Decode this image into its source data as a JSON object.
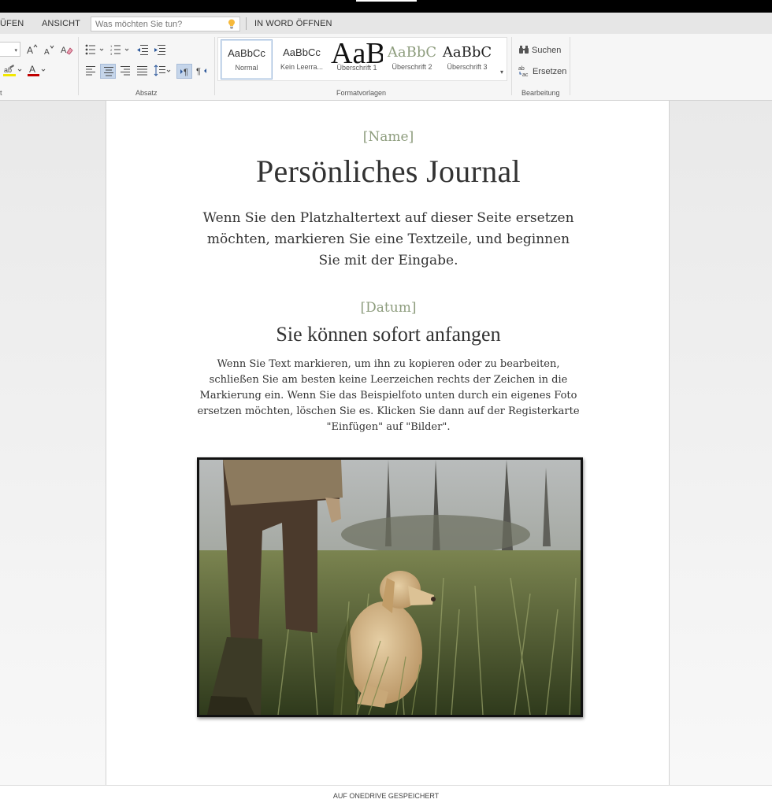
{
  "menubar": {
    "items": [
      "ÜFEN",
      "ANSICHT"
    ],
    "tell_me_placeholder": "Was möchten Sie tun?",
    "open_in_word": "IN WORD ÖFFNEN"
  },
  "ribbon": {
    "groups": {
      "font_label_fragment": "t",
      "paragraph": "Absatz",
      "styles": "Formatvorlagen",
      "editing": "Bearbeitung"
    },
    "styles": [
      {
        "preview": "AaBbCc",
        "label": "Normal",
        "active": true
      },
      {
        "preview": "AaBbCc",
        "label": "Kein Leerra...",
        "active": false
      },
      {
        "preview": "AaB",
        "label": "Überschrift 1",
        "active": false
      },
      {
        "preview": "AaBbC",
        "label": "Überschrift 2",
        "active": false
      },
      {
        "preview": "AaBbC",
        "label": "Überschrift 3",
        "active": false
      }
    ],
    "editing": {
      "find": "Suchen",
      "replace": "Ersetzen"
    },
    "icons": [
      "font-grow-icon",
      "font-shrink-icon",
      "clear-format-icon",
      "highlight-icon",
      "font-color-icon",
      "bullets-icon",
      "numbering-icon",
      "outdent-icon",
      "indent-icon",
      "align-left-icon",
      "align-center-icon",
      "align-right-icon",
      "justify-icon",
      "line-spacing-icon",
      "ltr-icon",
      "rtl-icon",
      "binoculars-icon",
      "replace-icon"
    ],
    "colors": {
      "highlight": "#f2e700",
      "font_color": "#c00000",
      "accent": "#2b579a"
    }
  },
  "document": {
    "name_placeholder": "[Name]",
    "title": "Persönliches Journal",
    "intro": "Wenn Sie den Platzhaltertext auf dieser Seite ersetzen möchten, markieren Sie eine Textzeile, und beginnen Sie mit der Eingabe.",
    "date_placeholder": "[Datum]",
    "heading": "Sie können sofort anfangen",
    "body": "Wenn Sie Text markieren, um ihn zu kopieren oder zu bearbeiten, schließen Sie am besten keine Leerzeichen rechts der Zeichen in die Markierung ein. Wenn Sie das Beispielfoto unten durch ein eigenes Foto ersetzen möchten, löschen Sie es. Klicken Sie dann auf der Registerkarte \"Einfügen\" auf \"Bilder\".",
    "accent_color": "#8e9d7e"
  },
  "statusbar": {
    "text": "AUF ONEDRIVE GESPEICHERT"
  }
}
